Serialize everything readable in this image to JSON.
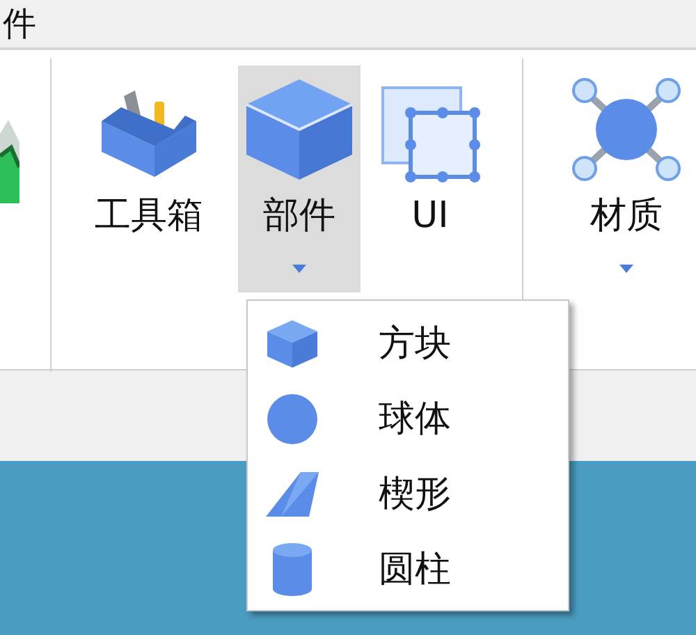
{
  "tab_strip": {
    "label": "件"
  },
  "ribbon": {
    "tools": [
      {
        "label": "工具箱",
        "kind": "toolbox",
        "selected": false,
        "has_dropdown": false
      },
      {
        "label": "部件",
        "kind": "part",
        "selected": true,
        "has_dropdown": true
      },
      {
        "label": "UI",
        "kind": "ui",
        "selected": false,
        "has_dropdown": false
      }
    ],
    "material": {
      "label": "材质",
      "has_dropdown": true
    }
  },
  "menu": {
    "items": [
      {
        "label": "方块",
        "kind": "block"
      },
      {
        "label": "球体",
        "kind": "sphere"
      },
      {
        "label": "楔形",
        "kind": "wedge"
      },
      {
        "label": "圆柱",
        "kind": "cylinder"
      }
    ]
  }
}
